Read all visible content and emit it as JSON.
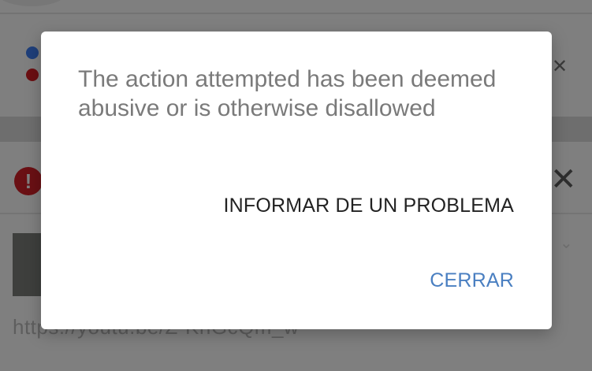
{
  "background": {
    "url_fragment": "https://youtu.be/Z-KnGcQm_w"
  },
  "dialog": {
    "message": "The action attempted has been deemed abusive or is otherwise disallowed",
    "report_label": "INFORMAR DE UN PROBLEMA",
    "close_label": "CERRAR",
    "accent_color": "#4a7fc1"
  },
  "icons": {
    "error": "error-icon",
    "close": "close-icon"
  }
}
